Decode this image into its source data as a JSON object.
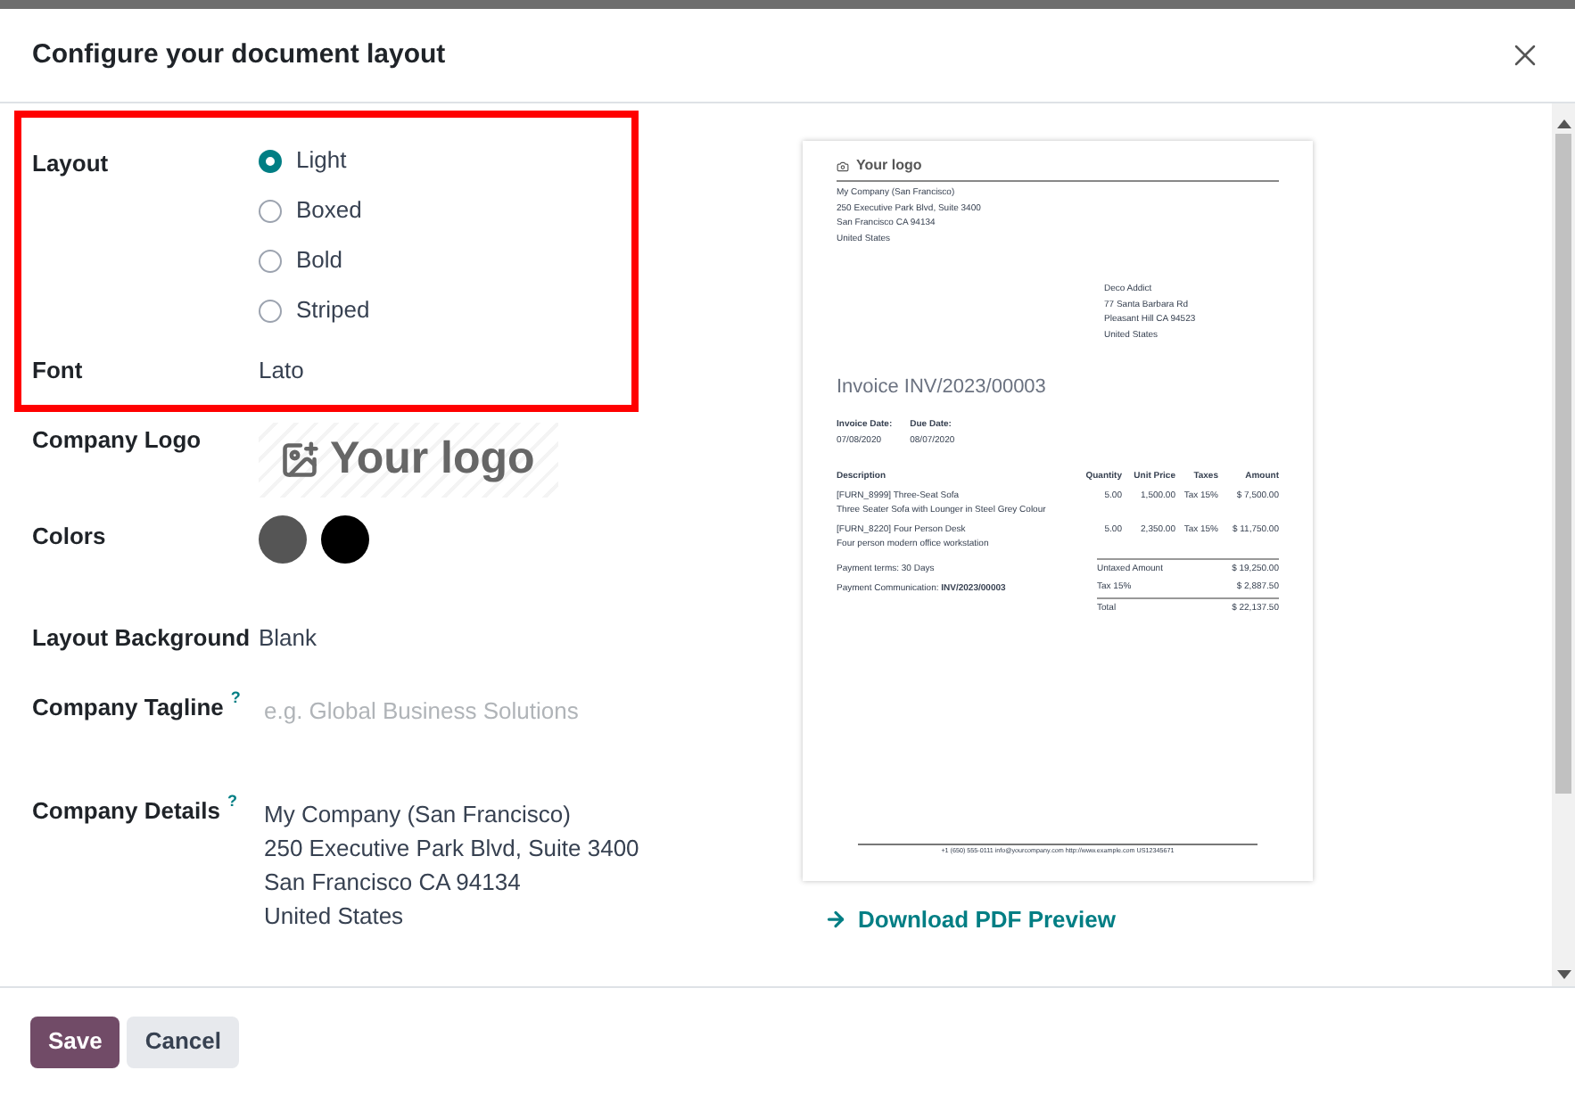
{
  "dialog": {
    "title": "Configure your document layout"
  },
  "layout": {
    "label": "Layout",
    "options": [
      {
        "label": "Light",
        "selected": true
      },
      {
        "label": "Boxed",
        "selected": false
      },
      {
        "label": "Bold",
        "selected": false
      },
      {
        "label": "Striped",
        "selected": false
      }
    ]
  },
  "font": {
    "label": "Font",
    "value": "Lato"
  },
  "company_logo": {
    "label": "Company Logo",
    "placeholder": "Your logo"
  },
  "colors": {
    "label": "Colors",
    "swatches": [
      {
        "color": "#555555"
      },
      {
        "color": "#000000"
      }
    ]
  },
  "layout_background": {
    "label": "Layout Background",
    "value": "Blank"
  },
  "company_tagline": {
    "label": "Company Tagline",
    "help": "?",
    "placeholder": "e.g. Global Business Solutions"
  },
  "company_details": {
    "label": "Company Details",
    "help": "?",
    "lines": [
      "My Company (San Francisco)",
      "250 Executive Park Blvd, Suite 3400",
      "San Francisco CA 94134",
      "United States"
    ]
  },
  "preview": {
    "logo": "Your logo",
    "company_lines": [
      "My Company (San Francisco)",
      "250 Executive Park Blvd, Suite 3400",
      "San Francisco CA 94134",
      "United States"
    ],
    "customer_lines": [
      "Deco Addict",
      "77 Santa Barbara Rd",
      "Pleasant Hill CA 94523",
      "United States"
    ],
    "invoice_title": "Invoice INV/2023/00003",
    "dates": [
      {
        "label": "Invoice Date:",
        "value": "07/08/2020"
      },
      {
        "label": "Due Date:",
        "value": "08/07/2020"
      }
    ],
    "columns": [
      "Description",
      "Quantity",
      "Unit Price",
      "Taxes",
      "Amount"
    ],
    "rows": [
      {
        "description": "[FURN_8999] Three-Seat Sofa",
        "note": "Three Seater Sofa with Lounger in Steel Grey Colour",
        "quantity": "5.00",
        "unit_price": "1,500.00",
        "taxes": "Tax 15%",
        "amount": "$ 7,500.00"
      },
      {
        "description": "[FURN_8220] Four Person Desk",
        "note": "Four person modern office workstation",
        "quantity": "5.00",
        "unit_price": "2,350.00",
        "taxes": "Tax 15%",
        "amount": "$ 11,750.00"
      }
    ],
    "payment_terms": "Payment terms: 30 Days",
    "payment_communication": "Payment Communication: **INV/2023/00003**",
    "totals": [
      {
        "label": "Untaxed Amount",
        "value": "$ 19,250.00"
      },
      {
        "label": "Tax 15%",
        "value": "$ 2,887.50"
      },
      {
        "label": "Total",
        "value": "$ 22,137.50"
      }
    ],
    "footer": "+1 (650) 555-0111 info@yourcompany.com http://www.example.com US12345671"
  },
  "download_link": "Download PDF Preview",
  "buttons": [
    {
      "label": "Save",
      "kind": "primary"
    },
    {
      "label": "Cancel",
      "kind": "secondary"
    }
  ]
}
